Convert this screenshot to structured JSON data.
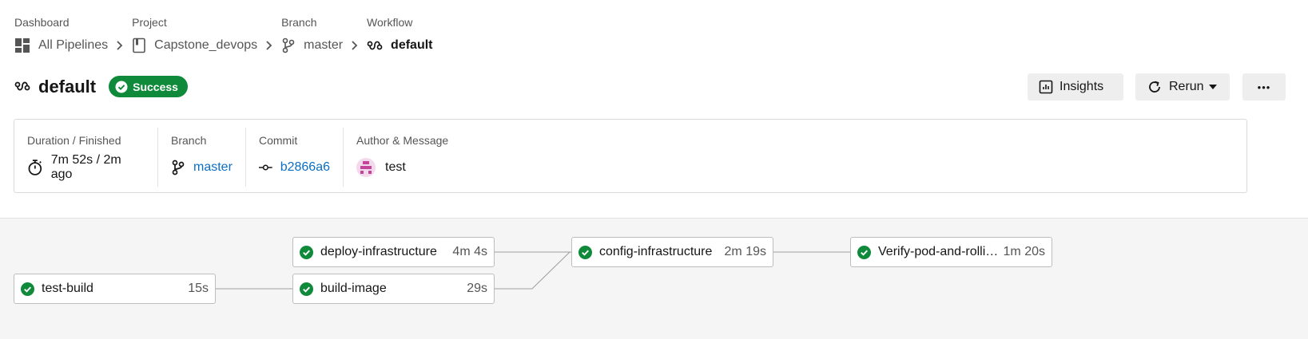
{
  "breadcrumb": [
    {
      "label": "Dashboard",
      "value": "All Pipelines",
      "icon": "dashboard-icon"
    },
    {
      "label": "Project",
      "value": "Capstone_devops",
      "icon": "project-icon"
    },
    {
      "label": "Branch",
      "value": "master",
      "icon": "branch-icon"
    },
    {
      "label": "Workflow",
      "value": "default",
      "icon": "workflow-icon"
    }
  ],
  "header": {
    "title": "default",
    "status": "Success",
    "status_color": "#0f8a3a",
    "insights_label": "Insights",
    "rerun_label": "Rerun",
    "more_label": "•••"
  },
  "details": {
    "duration_label": "Duration / Finished",
    "duration_value": "7m 52s / 2m ago",
    "branch_label": "Branch",
    "branch_value": "master",
    "commit_label": "Commit",
    "commit_value": "b2866a6",
    "author_label": "Author & Message",
    "author_message": "test"
  },
  "jobs": [
    {
      "name": "test-build",
      "duration": "15s",
      "status": "success"
    },
    {
      "name": "deploy-infrastructure",
      "duration": "4m 4s",
      "status": "success"
    },
    {
      "name": "build-image",
      "duration": "29s",
      "status": "success"
    },
    {
      "name": "config-infrastructure",
      "duration": "2m 19s",
      "status": "success"
    },
    {
      "name": "Verify-pod-and-rolling-...",
      "duration": "1m 20s",
      "status": "success"
    }
  ],
  "colors": {
    "link": "#0b6ec5",
    "success": "#0f8a3a"
  }
}
